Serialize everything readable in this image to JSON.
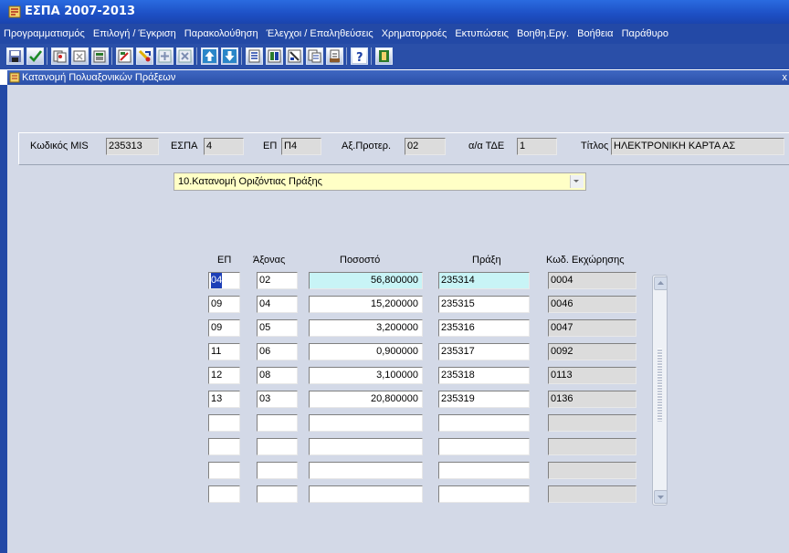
{
  "window": {
    "title": "ΕΣΠΑ 2007-2013"
  },
  "menu": [
    "Προγραμματισμός",
    "Επιλογή / Έγκριση",
    "Παρακολούθηση",
    "Έλεγχοι / Επαληθεύσεις",
    "Χρηματορροές",
    "Εκτυπώσεις",
    "Βοηθη.Εργ.",
    "Βοήθεια",
    "Παράθυρο"
  ],
  "toolbar": [
    "save-icon",
    "accept-icon",
    "copy-icon",
    "clear-icon",
    "paste-icon",
    "edit-icon",
    "cut-icon",
    "new-record-icon",
    "delete-record-icon",
    "up-arrow-icon",
    "down-arrow-icon",
    "list-icon",
    "query-icon",
    "execute-query-icon",
    "duplicate-icon",
    "print-icon",
    "help-icon",
    "exit-icon"
  ],
  "form": {
    "title": "Κατανομή Πολυαξονικών Πράξεων",
    "close": "x"
  },
  "header": {
    "mis_label": "Κωδικός MIS",
    "mis_value": "235313",
    "espa_label": "ΕΣΠΑ",
    "espa_value": "4",
    "ep_label": "ΕΠ",
    "ep_value": "Π4",
    "ax_label": "Αξ.Προτερ.",
    "ax_value": "02",
    "tde_label": "α/α ΤΔΕ",
    "tde_value": "1",
    "title_label": "Τίτλος",
    "title_value": "ΗΛΕΚΤΡΟΝΙΚΗ ΚΑΡΤΑ ΑΣ"
  },
  "dropdown": {
    "value": "10.Κατανομή Οριζόντιας Πράξης"
  },
  "table": {
    "columns": [
      "ΕΠ",
      "Άξονας",
      "Ποσοστό",
      "Πράξη",
      "Κωδ. Εκχώρησης"
    ],
    "rows": [
      {
        "ep": "04",
        "axonas": "02",
        "pososto": "56,800000",
        "praxi": "235314",
        "kod": "0004"
      },
      {
        "ep": "09",
        "axonas": "04",
        "pososto": "15,200000",
        "praxi": "235315",
        "kod": "0046"
      },
      {
        "ep": "09",
        "axonas": "05",
        "pososto": "3,200000",
        "praxi": "235316",
        "kod": "0047"
      },
      {
        "ep": "11",
        "axonas": "06",
        "pososto": "0,900000",
        "praxi": "235317",
        "kod": "0092"
      },
      {
        "ep": "12",
        "axonas": "08",
        "pososto": "3,100000",
        "praxi": "235318",
        "kod": "0113"
      },
      {
        "ep": "13",
        "axonas": "03",
        "pososto": "20,800000",
        "praxi": "235319",
        "kod": "0136"
      },
      {
        "ep": "",
        "axonas": "",
        "pososto": "",
        "praxi": "",
        "kod": ""
      },
      {
        "ep": "",
        "axonas": "",
        "pososto": "",
        "praxi": "",
        "kod": ""
      },
      {
        "ep": "",
        "axonas": "",
        "pososto": "",
        "praxi": "",
        "kod": ""
      },
      {
        "ep": "",
        "axonas": "",
        "pososto": "",
        "praxi": "",
        "kod": ""
      }
    ]
  },
  "colors": {
    "titlebar": "#1d4fc4",
    "menubar": "#2349a6",
    "panel": "#d3d9e7",
    "highlight": "#c8f4f6",
    "dropdown": "#ffffc6"
  }
}
